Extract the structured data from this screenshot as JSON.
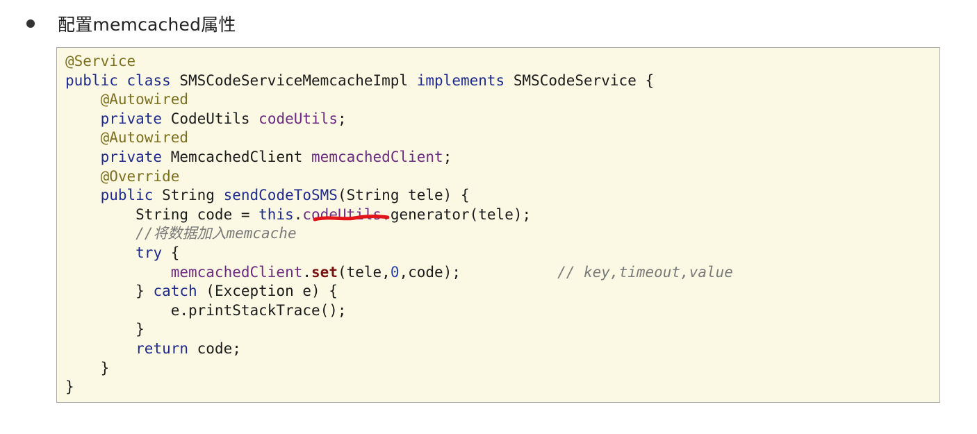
{
  "heading": "配置memcached属性",
  "code_lines": [
    [
      {
        "t": "@Service",
        "c": "annotation"
      }
    ],
    [
      {
        "t": "public",
        "c": "keyword"
      },
      {
        "t": " ",
        "c": "plain"
      },
      {
        "t": "class",
        "c": "keyword"
      },
      {
        "t": " SMSCodeServiceMemcacheImpl ",
        "c": "plain"
      },
      {
        "t": "implements",
        "c": "keyword"
      },
      {
        "t": " SMSCodeService {",
        "c": "plain"
      }
    ],
    [
      {
        "t": "    ",
        "c": "plain"
      },
      {
        "t": "@Autowired",
        "c": "annotation"
      }
    ],
    [
      {
        "t": "    ",
        "c": "plain"
      },
      {
        "t": "private",
        "c": "keyword"
      },
      {
        "t": " CodeUtils ",
        "c": "plain"
      },
      {
        "t": "codeUtils",
        "c": "field"
      },
      {
        "t": ";",
        "c": "plain"
      }
    ],
    [
      {
        "t": "    ",
        "c": "plain"
      },
      {
        "t": "@Autowired",
        "c": "annotation"
      }
    ],
    [
      {
        "t": "    ",
        "c": "plain"
      },
      {
        "t": "private",
        "c": "keyword"
      },
      {
        "t": " MemcachedClient ",
        "c": "plain"
      },
      {
        "t": "memcachedClient",
        "c": "field"
      },
      {
        "t": ";",
        "c": "plain"
      }
    ],
    [
      {
        "t": "    ",
        "c": "plain"
      },
      {
        "t": "@Override",
        "c": "annotation"
      }
    ],
    [
      {
        "t": "    ",
        "c": "plain"
      },
      {
        "t": "public",
        "c": "keyword"
      },
      {
        "t": " String ",
        "c": "plain"
      },
      {
        "t": "sendCodeToSMS",
        "c": "keyword"
      },
      {
        "t": "(String tele) {",
        "c": "plain"
      }
    ],
    [
      {
        "t": "        String code = ",
        "c": "plain"
      },
      {
        "t": "this",
        "c": "keyword"
      },
      {
        "t": ".",
        "c": "plain"
      },
      {
        "t": "codeUtils",
        "c": "field"
      },
      {
        "t": ".generator(tele);",
        "c": "plain"
      }
    ],
    [
      {
        "t": "        ",
        "c": "plain"
      },
      {
        "t": "//将数据加入memcache",
        "c": "comment"
      }
    ],
    [
      {
        "t": "        ",
        "c": "plain"
      },
      {
        "t": "try",
        "c": "keyword"
      },
      {
        "t": " {",
        "c": "plain"
      }
    ],
    [
      {
        "t": "            ",
        "c": "plain"
      },
      {
        "t": "memcachedClient",
        "c": "field"
      },
      {
        "t": ".",
        "c": "plain"
      },
      {
        "t": "set",
        "c": "method-bold"
      },
      {
        "t": "(tele,",
        "c": "plain"
      },
      {
        "t": "0",
        "c": "number"
      },
      {
        "t": ",code);           ",
        "c": "plain"
      },
      {
        "t": "// key,timeout,value",
        "c": "comment"
      }
    ],
    [
      {
        "t": "        } ",
        "c": "plain"
      },
      {
        "t": "catch",
        "c": "keyword"
      },
      {
        "t": " (Exception e) {",
        "c": "plain"
      }
    ],
    [
      {
        "t": "            e.printStackTrace();",
        "c": "plain"
      }
    ],
    [
      {
        "t": "        }",
        "c": "plain"
      }
    ],
    [
      {
        "t": "        ",
        "c": "plain"
      },
      {
        "t": "return",
        "c": "keyword"
      },
      {
        "t": " code;",
        "c": "plain"
      }
    ],
    [
      {
        "t": "    }",
        "c": "plain"
      }
    ],
    [
      {
        "t": "}",
        "c": "plain"
      }
    ]
  ],
  "colors": {
    "annotation": "#7c7020",
    "keyword": "#1e2a8c",
    "field": "#6c2a80",
    "method": "#7a1414",
    "comment": "#7a7a7a",
    "marker": "#e3141a",
    "code_background": "#fbf9e3"
  },
  "icons": {
    "bullet": "bullet-dot-icon",
    "highlight": "red-underline-mark"
  }
}
